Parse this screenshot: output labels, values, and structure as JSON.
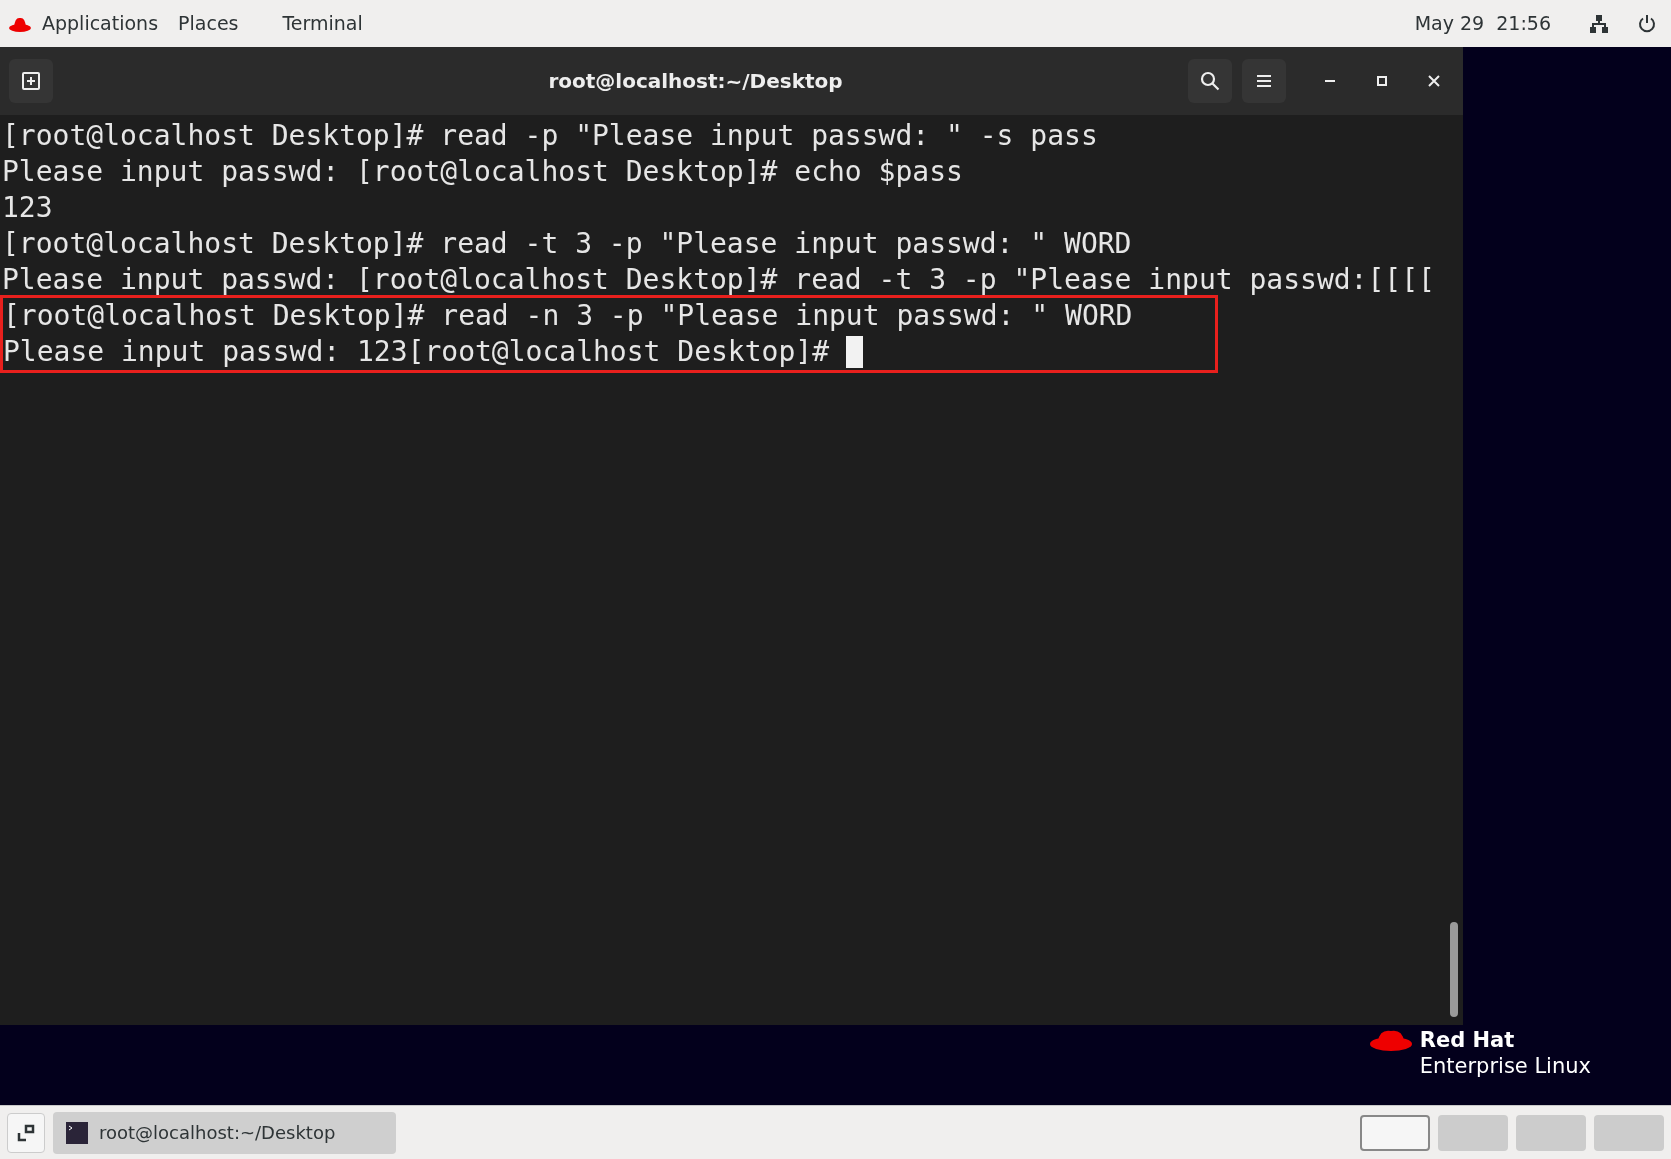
{
  "top_bar": {
    "menus": [
      "Applications",
      "Places",
      "Terminal"
    ],
    "clock": "May 29  21:56"
  },
  "terminal": {
    "title": "root@localhost:~/Desktop",
    "cursor": true,
    "lines": [
      {
        "text": "[root@localhost Desktop]# read -p \"Please input passwd: \" -s pass",
        "highlighted": false
      },
      {
        "text": "Please input passwd: [root@localhost Desktop]# echo $pass",
        "highlighted": false
      },
      {
        "text": "123",
        "highlighted": false
      },
      {
        "text": "[root@localhost Desktop]# read -t 3 -p \"Please input passwd: \" WORD",
        "highlighted": false
      },
      {
        "text": "Please input passwd: [root@localhost Desktop]# read -t 3 -p \"Please input passwd:[[[[",
        "highlighted": false
      },
      {
        "text": "[root@localhost Desktop]# read -n 3 -p \"Please input passwd: \" WORD",
        "highlighted": true
      },
      {
        "text": "Please input passwd: 123[root@localhost Desktop]# ",
        "highlighted": true
      }
    ]
  },
  "logo": {
    "brand": "Red Hat",
    "product": "Enterprise Linux"
  },
  "taskbar": {
    "window_button": "root@localhost:~/Desktop",
    "workspaces": [
      {
        "selected": true
      },
      {
        "selected": false
      },
      {
        "selected": false
      },
      {
        "selected": false
      }
    ]
  }
}
